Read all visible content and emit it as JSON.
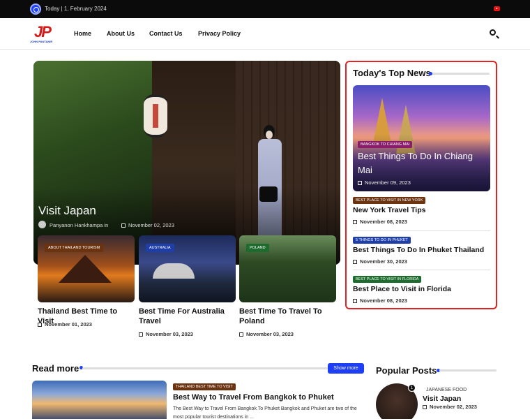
{
  "topbar": {
    "date_text": "Today | 1, February 2024",
    "social_icon": "youtube-icon"
  },
  "header": {
    "logo_text": "JP",
    "logo_sub": "JOHN PANTANIR",
    "nav": [
      "Home",
      "About Us",
      "Contact Us",
      "Privacy Policy"
    ],
    "search_icon": "search-icon"
  },
  "hero": {
    "title": "Visit Japan",
    "author": "Panyanon Hankhampa",
    "in_text": "in",
    "date": "November 02, 2023",
    "lantern_text": "鬼蛇"
  },
  "cards": [
    {
      "tag": "ABOUT THAILAND TOURISM",
      "tag_color": "#6b3310",
      "title": "Thailand Best Time to Visit",
      "date": "November 01, 2023"
    },
    {
      "tag": "AUSTRALIA",
      "tag_color": "#1f3ea8",
      "title": "Best Time For Australia Travel",
      "date": "November 03, 2023"
    },
    {
      "tag": "POLAND",
      "tag_color": "#1d6b2e",
      "title": "Best Time To Travel To Poland",
      "date": "November 03, 2023"
    }
  ],
  "top_news": {
    "heading": "Today's Top News",
    "feature": {
      "tag": "BANGKOK TO CHIANG MAI",
      "title": "Best Things To Do In Chiang Mai",
      "date": "November 09, 2023"
    },
    "items": [
      {
        "tag": "BEST PLACE TO VISIT IN NEW YORK",
        "tag_color": "#6b3310",
        "title": "New York Travel Tips",
        "date": "November 08, 2023"
      },
      {
        "tag": "5 THINGS TO DO IN PHUKET",
        "tag_color": "#1f3ea8",
        "title": "Best Things To Do In Phuket Thailand",
        "date": "November 30, 2023"
      },
      {
        "tag": "BEST PLACE TO VISIT IN FLORIDA",
        "tag_color": "#1d6b2e",
        "title": "Best Place to Visit in Florida",
        "date": "November 08, 2023"
      }
    ]
  },
  "read_more": {
    "heading": "Read more",
    "show_more": "Show more",
    "post": {
      "tag": "THAILAND BEST TIME TO VISIT",
      "title": "Best Way to Travel From Bangkok to Phuket",
      "excerpt": "The Best Way to Travel From Bangkok To Phuket Bangkok and Phuket are two of the most popular tourist destinations in ..."
    }
  },
  "popular": {
    "heading": "Popular Posts",
    "post": {
      "rank": "1",
      "tag": "JAPANESE FOOD",
      "title": "Visit Japan",
      "date": "November 02, 2023"
    }
  },
  "colors": {
    "accent": "#1e3ff5",
    "border_red": "#e02424"
  }
}
